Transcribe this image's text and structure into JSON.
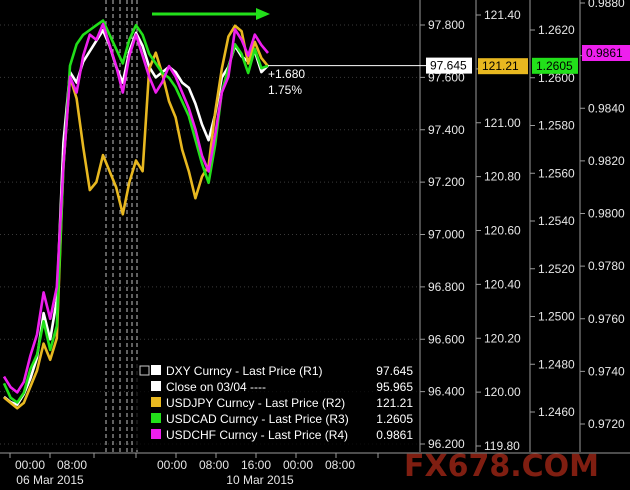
{
  "chart_data": {
    "type": "line",
    "xaxis": {
      "labels_top": [
        "00:00",
        "08:00",
        "00:00",
        "08:00",
        "16:00",
        "00:00",
        "08:00"
      ],
      "labels_date": [
        "06 Mar 2015",
        "10 Mar 2015"
      ]
    },
    "axes": {
      "R1": {
        "ticks": [
          "97.800",
          "97.600",
          "97.400",
          "97.200",
          "97.000",
          "96.800",
          "96.600",
          "96.400",
          "96.200"
        ],
        "range": [
          96.2,
          97.8
        ]
      },
      "R2": {
        "ticks": [
          "121.40",
          "121.20",
          "121.00",
          "120.80",
          "120.60",
          "120.40",
          "120.20",
          "120.00",
          "119.80"
        ],
        "range": [
          119.8,
          121.4
        ]
      },
      "R3": {
        "ticks": [
          "1.2620",
          "1.2600",
          "1.2580",
          "1.2560",
          "1.2540",
          "1.2520",
          "1.2500",
          "1.2480",
          "1.2460"
        ],
        "range": [
          1.2446,
          1.2632
        ]
      },
      "R4": {
        "ticks": [
          "0.9880",
          "0.9860",
          "0.9840",
          "0.9820",
          "0.9800",
          "0.9780",
          "0.9760",
          "0.9740",
          "0.9720"
        ],
        "range": [
          0.9713,
          0.9878
        ]
      }
    },
    "last_value_tags": {
      "R1": "97.645",
      "R2": "121.21",
      "R3": "1.2605",
      "R4": "0.9861"
    },
    "annotation": {
      "change": "+1.680",
      "percent": "1.75%"
    },
    "legend": [
      {
        "label": "DXY Curncy - Last Price (R1)",
        "value": "97.645",
        "color": "#ffffff"
      },
      {
        "label": "Close on 03/04 ----",
        "value": "95.965",
        "color": "#ffffff"
      },
      {
        "label": "USDJPY Curncy - Last Price (R2)",
        "value": "121.21",
        "color": "#e8b820"
      },
      {
        "label": "USDCAD Curncy - Last Price (R3)",
        "value": "1.2605",
        "color": "#22e01a"
      },
      {
        "label": "USDCHF Curncy - Last Price (R4)",
        "value": "0.9861",
        "color": "#ee1fee"
      }
    ],
    "series": [
      {
        "name": "DXY Curncy",
        "color": "#ffffff",
        "axis": "R1",
        "values": [
          96.38,
          96.36,
          96.35,
          96.39,
          96.45,
          96.53,
          96.7,
          96.6,
          96.75,
          97.35,
          97.62,
          97.58,
          97.66,
          97.7,
          97.74,
          97.78,
          97.72,
          97.64,
          97.58,
          97.7,
          97.77,
          97.72,
          97.64,
          97.6,
          97.62,
          97.64,
          97.62,
          97.58,
          97.56,
          97.5,
          97.42,
          97.36,
          97.46,
          97.6,
          97.64,
          97.72,
          97.68,
          97.66,
          97.7,
          97.62,
          97.645
        ]
      },
      {
        "name": "USDJPY Curncy",
        "color": "#e8b820",
        "axis": "R2",
        "values": [
          119.98,
          119.96,
          119.94,
          119.96,
          120.02,
          120.08,
          120.18,
          120.12,
          120.2,
          120.84,
          121.17,
          121.09,
          120.91,
          120.75,
          120.78,
          120.88,
          120.82,
          120.76,
          120.66,
          120.78,
          120.86,
          120.82,
          121.2,
          121.26,
          121.18,
          121.08,
          121.02,
          120.9,
          120.82,
          120.72,
          120.8,
          120.84,
          121.04,
          121.2,
          121.32,
          121.36,
          121.34,
          121.22,
          121.3,
          121.24,
          121.21
        ]
      },
      {
        "name": "USDCAD Curncy",
        "color": "#22e01a",
        "axis": "R3",
        "values": [
          1.2472,
          1.2466,
          1.2464,
          1.2468,
          1.2478,
          1.2484,
          1.2498,
          1.2486,
          1.2496,
          1.2562,
          1.2605,
          1.2614,
          1.2618,
          1.262,
          1.2622,
          1.2624,
          1.2618,
          1.2612,
          1.2606,
          1.2616,
          1.2622,
          1.2618,
          1.261,
          1.2606,
          1.2602,
          1.26,
          1.2596,
          1.259,
          1.2584,
          1.2574,
          1.2564,
          1.2556,
          1.2572,
          1.2594,
          1.2604,
          1.2614,
          1.261,
          1.2602,
          1.2612,
          1.2604,
          1.2605
        ]
      },
      {
        "name": "USDCHF Curncy",
        "color": "#ee1fee",
        "axis": "R4",
        "values": [
          0.9738,
          0.9734,
          0.9732,
          0.9736,
          0.9746,
          0.9754,
          0.977,
          0.976,
          0.9772,
          0.9818,
          0.9852,
          0.9846,
          0.986,
          0.9868,
          0.9866,
          0.9872,
          0.9864,
          0.9856,
          0.9846,
          0.986,
          0.9868,
          0.986,
          0.9852,
          0.9846,
          0.985,
          0.9856,
          0.9852,
          0.9846,
          0.984,
          0.9832,
          0.9822,
          0.9816,
          0.983,
          0.9846,
          0.9852,
          0.987,
          0.9866,
          0.986,
          0.9868,
          0.9864,
          0.9861
        ]
      }
    ]
  },
  "watermark": {
    "text": "FX678.COM",
    "color": "#e8371f"
  }
}
